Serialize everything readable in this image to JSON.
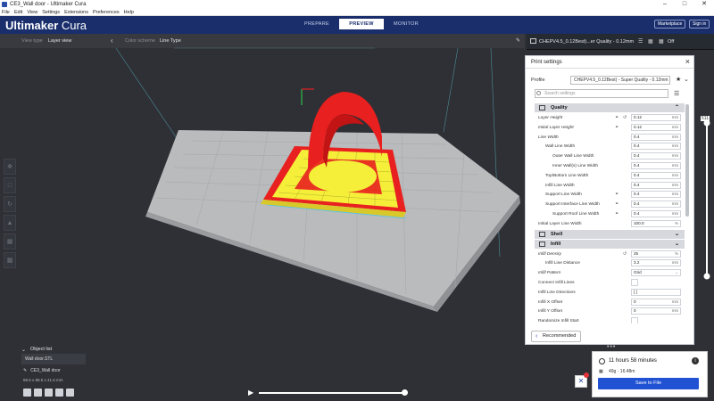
{
  "window": {
    "title": "CE3_Wall door - Ultimaker Cura"
  },
  "menu": [
    "File",
    "Edit",
    "View",
    "Settings",
    "Extensions",
    "Preferences",
    "Help"
  ],
  "header": {
    "brand_bold": "Ultimaker",
    "brand_light": " Cura",
    "stages": [
      "PREPARE",
      "PREVIEW",
      "MONITOR"
    ],
    "active_stage": "PREVIEW",
    "marketplace": "Marketplace",
    "signin": "Sign in"
  },
  "view_bar": {
    "view_type_label": "View type",
    "view_type_value": "Layer view",
    "color_scheme_label": "Color scheme",
    "color_scheme_value": "Line Type"
  },
  "printer_bar": {
    "profile_short": "CHEPV4.5_0.12Best)...er Quality - 0.12mm",
    "support_value": "Off"
  },
  "print_settings": {
    "title": "Print settings",
    "profile_label": "Profile",
    "profile_value": "CHEPV4.5_0.12Best) - Super Quality - 0.12mm",
    "search_placeholder": "Search settings",
    "categories": {
      "quality": "Quality",
      "shell": "Shell",
      "infill": "Infill"
    },
    "quality_rows": [
      {
        "name": "Layer Height",
        "value": "0.12",
        "unit": "mm",
        "indent": 0,
        "italic": true,
        "link": true,
        "reset": true
      },
      {
        "name": "Initial Layer Height",
        "value": "0.12",
        "unit": "mm",
        "indent": 0,
        "italic": true,
        "link": true,
        "reset": false
      },
      {
        "name": "Line Width",
        "value": "0.4",
        "unit": "mm",
        "indent": 0,
        "italic": true,
        "link": false,
        "reset": false
      },
      {
        "name": "Wall Line Width",
        "value": "0.4",
        "unit": "mm",
        "indent": 1,
        "italic": false,
        "link": false,
        "reset": false
      },
      {
        "name": "Outer Wall Line Width",
        "value": "0.4",
        "unit": "mm",
        "indent": 2,
        "italic": false,
        "link": false,
        "reset": false
      },
      {
        "name": "Inner Wall(s) Line Width",
        "value": "0.4",
        "unit": "mm",
        "indent": 2,
        "italic": false,
        "link": false,
        "reset": false
      },
      {
        "name": "Top/Bottom Line Width",
        "value": "0.4",
        "unit": "mm",
        "indent": 1,
        "italic": false,
        "link": false,
        "reset": false
      },
      {
        "name": "Infill Line Width",
        "value": "0.4",
        "unit": "mm",
        "indent": 1,
        "italic": false,
        "link": false,
        "reset": false
      },
      {
        "name": "Support Line Width",
        "value": "0.4",
        "unit": "mm",
        "indent": 1,
        "italic": false,
        "link": true,
        "reset": false
      },
      {
        "name": "Support Interface Line Width",
        "value": "0.4",
        "unit": "mm",
        "indent": 1,
        "italic": false,
        "link": true,
        "reset": false
      },
      {
        "name": "Support Roof Line Width",
        "value": "0.4",
        "unit": "mm",
        "indent": 2,
        "italic": false,
        "link": true,
        "reset": false
      },
      {
        "name": "Initial Layer Line Width",
        "value": "100.0",
        "unit": "%",
        "indent": 0,
        "italic": false,
        "link": false,
        "reset": false
      }
    ],
    "infill_rows": [
      {
        "name": "Infill Density",
        "value": "25",
        "unit": "%",
        "indent": 0,
        "italic": true,
        "link": false,
        "reset": true,
        "kind": "field"
      },
      {
        "name": "Infill Line Distance",
        "value": "3.2",
        "unit": "mm",
        "indent": 1,
        "italic": false,
        "link": false,
        "reset": false,
        "kind": "field"
      },
      {
        "name": "Infill Pattern",
        "value": "Grid",
        "unit": "",
        "indent": 0,
        "italic": true,
        "link": false,
        "reset": false,
        "kind": "select"
      },
      {
        "name": "Connect Infill Lines",
        "value": "",
        "unit": "",
        "indent": 0,
        "italic": false,
        "link": false,
        "reset": false,
        "kind": "check"
      },
      {
        "name": "Infill Line Directions",
        "value": "[ ]",
        "unit": "",
        "indent": 0,
        "italic": false,
        "link": false,
        "reset": false,
        "kind": "field"
      },
      {
        "name": "Infill X Offset",
        "value": "0",
        "unit": "mm",
        "indent": 0,
        "italic": false,
        "link": false,
        "reset": false,
        "kind": "field"
      },
      {
        "name": "Infill Y Offset",
        "value": "0",
        "unit": "mm",
        "indent": 0,
        "italic": false,
        "link": false,
        "reset": false,
        "kind": "field"
      },
      {
        "name": "Randomize Infill Start",
        "value": "",
        "unit": "",
        "indent": 0,
        "italic": false,
        "link": false,
        "reset": false,
        "kind": "check"
      }
    ],
    "recommended_label": "Recommended"
  },
  "layer_slider": {
    "current_layer": "511"
  },
  "object_list": {
    "header": "Object list",
    "selected_item": "Wall door.STL",
    "object_name": "CE3_Wall door",
    "dimensions": "88.5 x 88.5 x 41.6 mm"
  },
  "output": {
    "print_time": "11 hours 58 minutes",
    "material": "49g · 16.48m",
    "save_label": "Save to File"
  },
  "colors": {
    "header_bg": "#192e6b",
    "accent_blue": "#2052d3",
    "model_red": "#e8201f",
    "infill_yellow": "#f5ef3a",
    "bed_grey": "#b9bbbd"
  }
}
